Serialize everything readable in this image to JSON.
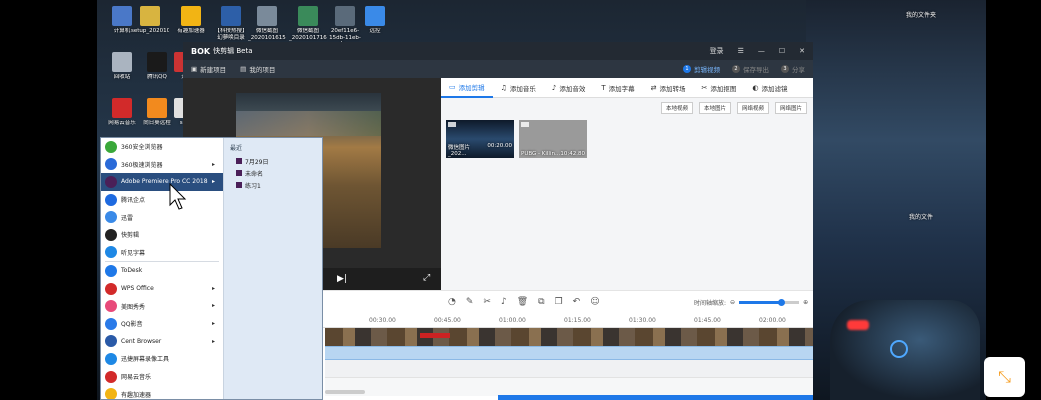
{
  "desktop": {
    "labels": {
      "my_files_top": "我的文件夹",
      "my_files_mid": "我的文件"
    },
    "icons": [
      {
        "label": "计算机",
        "color": "#4a78c8",
        "icon": "computer-icon"
      },
      {
        "label": "setup_20201026a",
        "color": "#d8b440",
        "icon": "installer-icon"
      },
      {
        "label": "有趣加速器",
        "color": "#f2b414",
        "icon": "accelerator-icon"
      },
      {
        "label": "【科技热搜】幻夢唤目录",
        "color": "#2d5fa8",
        "icon": "word-doc-icon"
      },
      {
        "label": "微信截图_20201016152...",
        "color": "#7a8a9a",
        "icon": "image-file-icon"
      },
      {
        "label": "微信截图_20201017165...",
        "color": "#3a8a5a",
        "icon": "image-file-icon"
      },
      {
        "label": "20ef11e6-15db-11eb-b...",
        "color": "#5a6a7a",
        "icon": "image-file-icon"
      },
      {
        "label": "远控",
        "color": "#3a8ae8",
        "icon": "remote-control-icon"
      },
      {
        "label": "回收站",
        "color": "#aab4c0",
        "icon": "recycle-bin-icon"
      },
      {
        "label": "腾讯QQ",
        "color": "#1a1a1a",
        "icon": "qq-icon"
      },
      {
        "label": "开",
        "color": "#cc3333",
        "icon": "app-icon"
      },
      {
        "label": "网易云音乐",
        "color": "#d22a2a",
        "icon": "netease-music-icon"
      },
      {
        "label": "向日葵远程",
        "color": "#f28a1e",
        "icon": "sunflower-icon"
      },
      {
        "label": "set",
        "color": "#e0e0e0",
        "icon": "app-icon"
      }
    ]
  },
  "window": {
    "logo": "BOK",
    "title": "快剪辑 Beta",
    "login": "登录",
    "menu": {
      "new_project": "新建项目",
      "my_projects": "我的项目"
    },
    "steps": [
      {
        "num": "1",
        "label": "剪辑视频"
      },
      {
        "num": "2",
        "label": "保存导出"
      },
      {
        "num": "3",
        "label": "分享"
      }
    ],
    "tabs": [
      {
        "label": "添加剪辑",
        "icon": "video-clip-icon"
      },
      {
        "label": "添加音乐",
        "icon": "music-icon"
      },
      {
        "label": "添加音效",
        "icon": "sound-effect-icon"
      },
      {
        "label": "添加字幕",
        "icon": "subtitle-icon"
      },
      {
        "label": "添加转场",
        "icon": "transition-icon"
      },
      {
        "label": "添加抠图",
        "icon": "cutout-icon"
      },
      {
        "label": "添加滤镜",
        "icon": "filter-icon"
      }
    ],
    "actions": {
      "local_video": "本地视频",
      "local_image": "本地图片",
      "net_video": "网络视频",
      "net_image": "网络图片"
    },
    "media": [
      {
        "name": "微信图片_202...",
        "duration": "00:20.00"
      },
      {
        "name": "PUBG - Killin...",
        "duration": "10:42.80"
      }
    ],
    "timeline": {
      "zoom_label": "时间轴缩放:",
      "zoom_level": 0.7,
      "ticks": [
        "00:30.00",
        "00:45.00",
        "01:00.00",
        "01:15.00",
        "01:30.00",
        "01:45.00",
        "02:00.00"
      ]
    }
  },
  "start_menu": {
    "items": [
      {
        "label": "360安全浏览器",
        "color": "#3aa83a",
        "arrow": false
      },
      {
        "label": "360极速浏览器",
        "color": "#2a6ad8",
        "arrow": true
      },
      {
        "label": "Adobe Premiere Pro CC 2018",
        "color": "#4a1f58",
        "arrow": true
      },
      {
        "label": "腾讯企点",
        "color": "#1e6ae0",
        "arrow": false
      },
      {
        "label": "迅雷",
        "color": "#3a8ae8",
        "arrow": false
      },
      {
        "label": "快剪辑",
        "color": "#222222",
        "arrow": false
      },
      {
        "label": "听见字幕",
        "color": "#1e88e5",
        "arrow": false
      },
      {
        "label": "ToDesk",
        "color": "#1e78e8",
        "arrow": false
      },
      {
        "label": "WPS Office",
        "color": "#d22a2a",
        "arrow": true
      },
      {
        "label": "美图秀秀",
        "color": "#e84a7a",
        "arrow": true
      },
      {
        "label": "QQ影音",
        "color": "#2a7ae8",
        "arrow": true
      },
      {
        "label": "Cent Browser",
        "color": "#2a5aa8",
        "arrow": true
      },
      {
        "label": "迅捷屏幕录像工具",
        "color": "#1e88e5",
        "arrow": false
      },
      {
        "label": "网易云音乐",
        "color": "#d22a2a",
        "arrow": false
      },
      {
        "label": "有趣加速器",
        "color": "#f2b414",
        "arrow": false
      }
    ],
    "recent_title": "最近",
    "recent": [
      "7月29日",
      "未命名",
      "练习1"
    ]
  }
}
